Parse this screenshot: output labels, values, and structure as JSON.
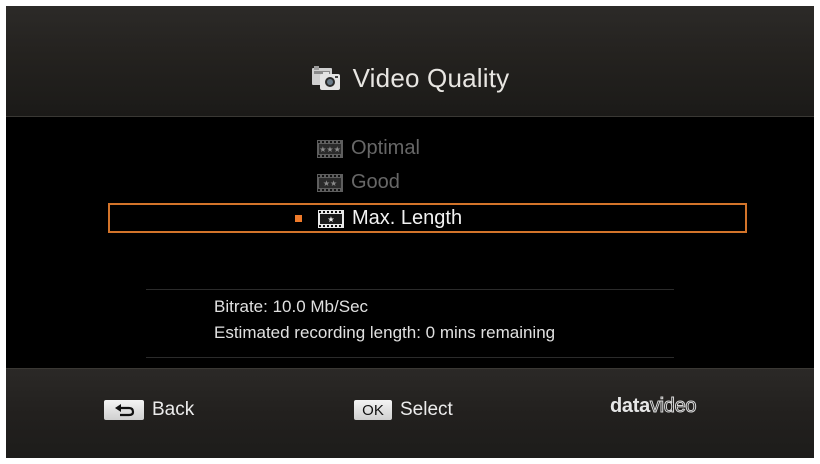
{
  "header": {
    "title": "Video Quality",
    "icon": "camera-settings-icon"
  },
  "options": [
    {
      "label": "Optimal",
      "icon": "three-star-film-icon",
      "selected": false
    },
    {
      "label": "Good",
      "icon": "two-star-film-icon",
      "selected": false
    },
    {
      "label": "Max. Length",
      "icon": "one-star-film-icon",
      "selected": true
    }
  ],
  "info": {
    "bitrate": "Bitrate:  10.0 Mb/Sec",
    "recording": "Estimated recording length: 0 mins remaining"
  },
  "footer": {
    "back_label": "Back",
    "ok_key": "OK",
    "select_label": "Select",
    "brand": "datavideo"
  },
  "colors": {
    "accent": "#d3742a",
    "dim_text": "#676767",
    "text": "#f2f2f2"
  }
}
